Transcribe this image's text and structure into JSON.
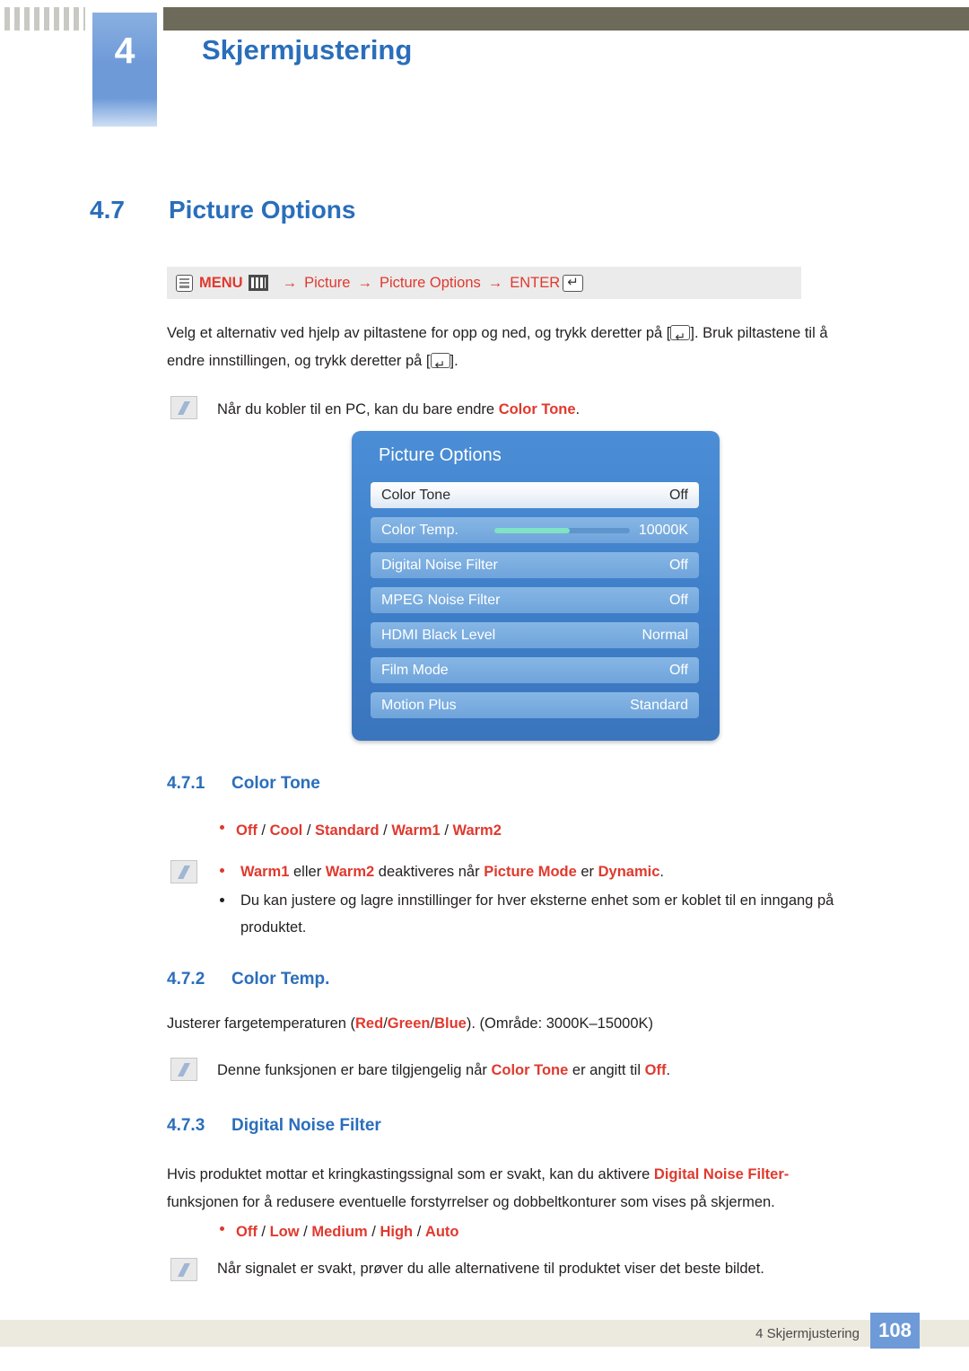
{
  "header": {
    "chapter_number": "4",
    "chapter_title": "Skjermjustering"
  },
  "section": {
    "number": "4.7",
    "title": "Picture Options"
  },
  "breadcrumb": {
    "menu_label": "MENU",
    "arrow": "→",
    "item1": "Picture",
    "item2": "Picture Options",
    "enter_label": "ENTER"
  },
  "intro": {
    "line1_a": "Velg et alternativ ved hjelp av piltastene for opp og ned, og trykk deretter på [",
    "line1_b": "]. Bruk piltastene til å",
    "line2_a": "endre innstillingen, og trykk deretter på [",
    "line2_b": "].",
    "note_a": "Når du kobler til en PC, kan du bare endre ",
    "note_b": "Color Tone",
    "note_c": "."
  },
  "osd": {
    "title": "Picture Options",
    "rows": [
      {
        "label": "Color Tone",
        "value": "Off",
        "selected": true,
        "slider": false
      },
      {
        "label": "Color Temp.",
        "value": "10000K",
        "selected": false,
        "slider": true
      },
      {
        "label": "Digital Noise Filter",
        "value": "Off",
        "selected": false,
        "slider": false
      },
      {
        "label": "MPEG Noise Filter",
        "value": "Off",
        "selected": false,
        "slider": false
      },
      {
        "label": "HDMI Black Level",
        "value": "Normal",
        "selected": false,
        "slider": false
      },
      {
        "label": "Film Mode",
        "value": "Off",
        "selected": false,
        "slider": false
      },
      {
        "label": "Motion Plus",
        "value": "Standard",
        "selected": false,
        "slider": false
      }
    ]
  },
  "sub471": {
    "number": "4.7.1",
    "title": "Color Tone",
    "options": [
      "Off",
      "Cool",
      "Standard",
      "Warm1",
      "Warm2"
    ],
    "note1_a": "Warm1",
    "note1_b": " eller ",
    "note1_c": "Warm2",
    "note1_d": " deaktiveres når ",
    "note1_e": "Picture Mode",
    "note1_f": " er ",
    "note1_g": "Dynamic",
    "note1_h": ".",
    "note2_line1": "Du kan justere og lagre innstillinger for hver eksterne enhet som er koblet til en inngang på",
    "note2_line2": "produktet."
  },
  "sub472": {
    "number": "4.7.2",
    "title": "Color Temp.",
    "body_a": "Justerer fargetemperaturen (",
    "body_red": "Red",
    "body_slash1": "/",
    "body_green": "Green",
    "body_slash2": "/",
    "body_blue": "Blue",
    "body_b": "). (Område: 3000K–15000K)",
    "note_a": "Denne funksjonen er bare tilgjengelig når ",
    "note_b": "Color Tone",
    "note_c": " er angitt til ",
    "note_d": "Off",
    "note_e": "."
  },
  "sub473": {
    "number": "4.7.3",
    "title": "Digital Noise Filter",
    "body_line1_a": "Hvis produktet mottar et kringkastingssignal som er svakt, kan du aktivere ",
    "body_line1_b": "Digital Noise Filter",
    "body_line1_c": "-",
    "body_line2": "funksjonen for å redusere eventuelle forstyrrelser og dobbeltkonturer som vises på skjermen.",
    "options": [
      "Off",
      "Low",
      "Medium",
      "High",
      "Auto"
    ],
    "note": "Når signalet er svakt, prøver du alle alternativene til produktet viser det beste bildet."
  },
  "footer": {
    "text": "4 Skjermjustering",
    "page": "108"
  }
}
